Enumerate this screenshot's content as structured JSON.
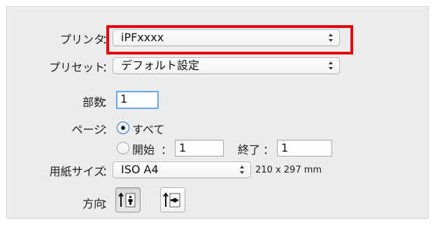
{
  "printer": {
    "label": "プリンタ",
    "value": "iPFxxxx"
  },
  "preset": {
    "label": "プリセット",
    "value": "デフォルト設定"
  },
  "copies": {
    "label": "部数",
    "value": "1"
  },
  "pages": {
    "label": "ページ",
    "all_label": "すべて",
    "from_label": "開始",
    "from_value": "1",
    "to_label": "終了",
    "to_value": "1",
    "selected": "all"
  },
  "paper_size": {
    "label": "用紙サイズ",
    "value": "ISO A4",
    "dimensions": "210 x 297 mm"
  },
  "orientation": {
    "label": "方向",
    "selected": "portrait",
    "options": [
      "portrait",
      "landscape"
    ]
  },
  "colon": "：",
  "colors": {
    "highlight": "#e60012",
    "focus": "#6aa6ea"
  }
}
